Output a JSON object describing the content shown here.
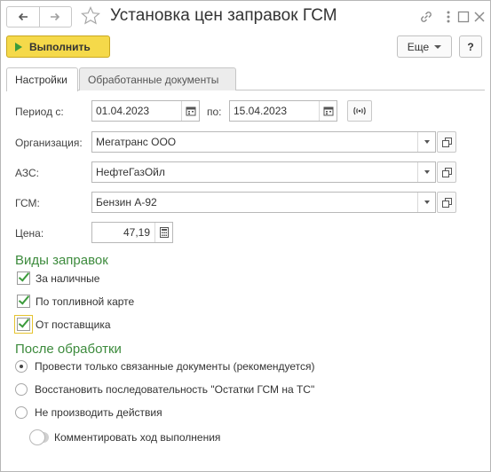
{
  "window": {
    "title": "Установка цен заправок ГСМ",
    "nav_back_icon": "arrow-left-icon",
    "nav_forward_icon": "arrow-right-icon",
    "favorite_icon": "star-icon",
    "title_icons": [
      "link-icon",
      "more-vertical-icon",
      "maximize-icon",
      "close-icon"
    ]
  },
  "toolbar": {
    "run_label": "Выполнить",
    "more_label": "Еще",
    "help_label": "?"
  },
  "tabs": [
    {
      "label": "Настройки",
      "active": true
    },
    {
      "label": "Обработанные документы",
      "active": false
    }
  ],
  "form": {
    "period_label": "Период с:",
    "period_from": "01.04.2023",
    "period_to_label": "по:",
    "period_to": "15.04.2023",
    "org_label": "Организация:",
    "org_value": "Мегатранс ООО",
    "azs_label": "АЗС:",
    "azs_value": "НефтеГазОйл",
    "fuel_label": "ГСМ:",
    "fuel_value": "Бензин А-92",
    "price_label": "Цена:",
    "price_value": "47,19"
  },
  "refuel_types": {
    "title": "Виды заправок",
    "items": [
      {
        "label": "За наличные",
        "checked": true
      },
      {
        "label": "По топливной карте",
        "checked": true
      },
      {
        "label": "От поставщика",
        "checked": true
      }
    ]
  },
  "after_processing": {
    "title": "После обработки",
    "options": [
      {
        "label": "Провести только связанные документы (рекомендуется)",
        "selected": true
      },
      {
        "label": "Восстановить последовательность \"Остатки ГСМ на ТС\"",
        "selected": false
      },
      {
        "label": "Не производить действия",
        "selected": false
      }
    ],
    "comment_label": "Комментировать ход выполнения",
    "comment_on": false
  },
  "colors": {
    "accent_yellow": "#f5d94a",
    "group_title_green": "#3d8b3d",
    "check_green": "#3c9b3c"
  }
}
